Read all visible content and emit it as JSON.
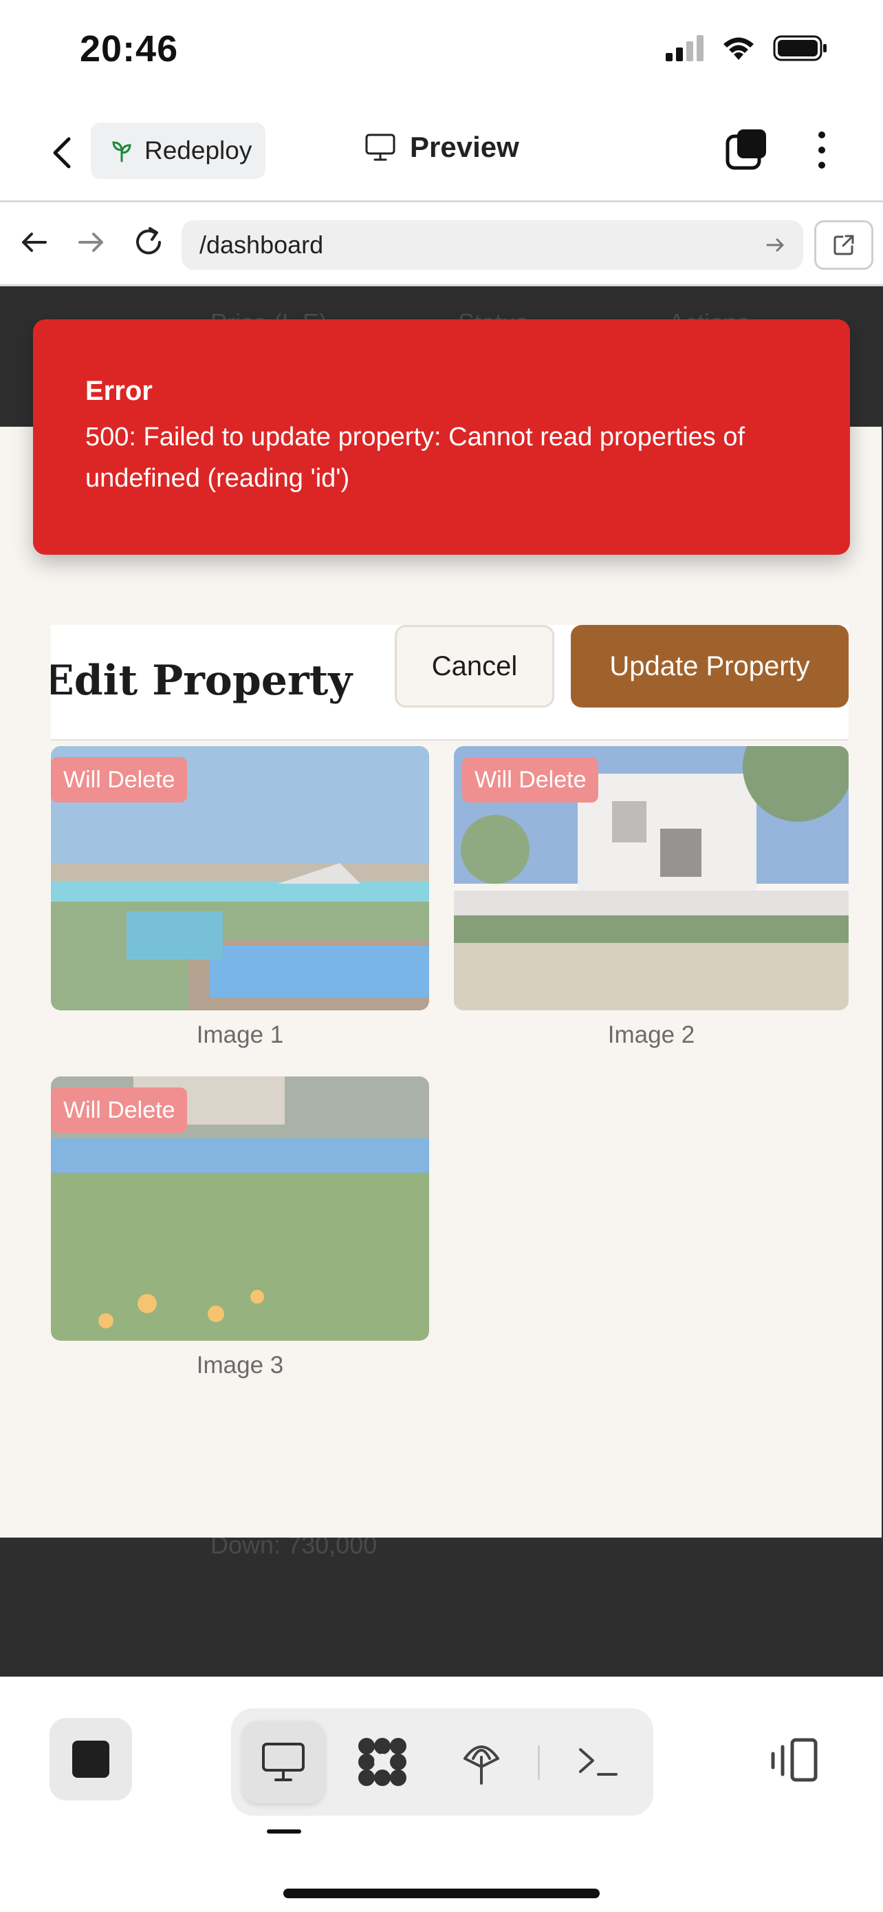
{
  "status_bar": {
    "time": "20:46"
  },
  "header": {
    "redeploy_label": "Redeploy",
    "preview_label": "Preview"
  },
  "browser": {
    "url": "/dashboard"
  },
  "background_table": {
    "col_price": "Price (L.E)",
    "col_status": "Status",
    "col_actions": "Actions",
    "down_payment": "Down: 730,000"
  },
  "toast": {
    "title": "Error",
    "message": "500: Failed to update property: Cannot read properties of undefined (reading 'id')"
  },
  "modal": {
    "title": "Edit Property",
    "cancel_label": "Cancel",
    "update_label": "Update Property",
    "images": [
      {
        "caption": "Image 1",
        "badge": "Will Delete"
      },
      {
        "caption": "Image 2",
        "badge": "Will Delete"
      },
      {
        "caption": "Image 3",
        "badge": "Will Delete"
      }
    ]
  },
  "colors": {
    "error_red": "#dc2626",
    "primary_brown": "#a0622c",
    "delete_badge": "#f08f8f",
    "modal_bg": "#f8f5f1"
  },
  "icons": [
    "back-icon",
    "sprout-icon",
    "monitor-icon",
    "tabs-icon",
    "more-icon",
    "arrow-left-icon",
    "arrow-right-icon",
    "reload-icon",
    "open-external-icon",
    "stop-icon",
    "desktop-icon",
    "apps-icon",
    "deploy-icon",
    "terminal-icon",
    "split-view-icon"
  ]
}
